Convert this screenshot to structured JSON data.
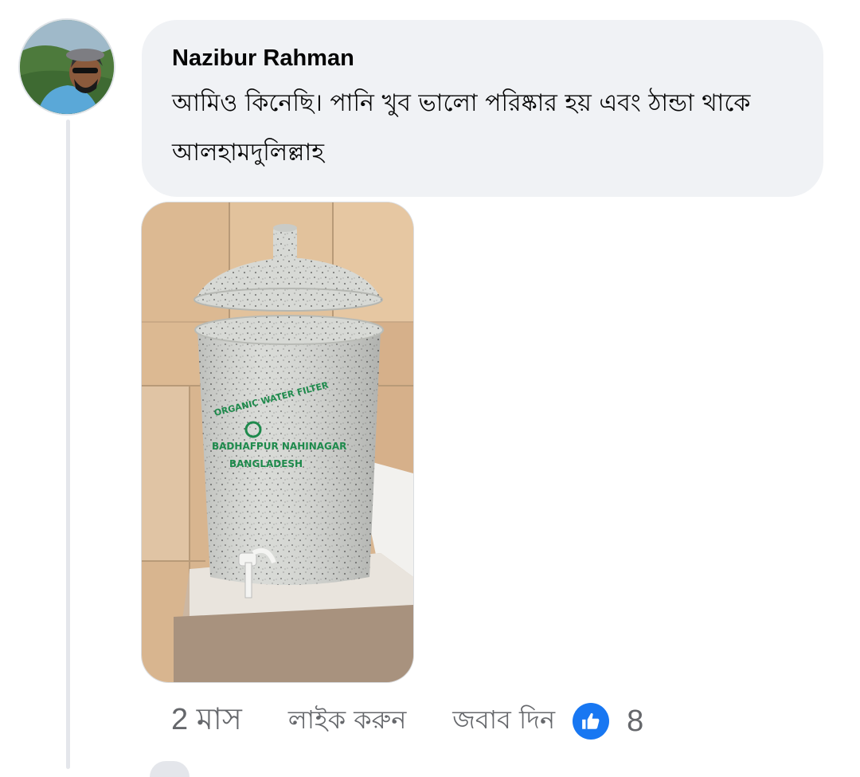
{
  "comment": {
    "author": "Nazibur Rahman",
    "text": "আমিও কিনেছি। পানি খুব ভালো পরিষ্কার হয় এবং ঠান্ডা থাকে আলহামদুলিল্লাহ",
    "time": "2 মাস",
    "like_label": "লাইক করুন",
    "reply_label": "জবাব দিন",
    "reaction_icon": "thumbs-up-icon",
    "reaction_count": "8"
  },
  "photo": {
    "stencil_text": [
      "ORGANIC WATER FILTER",
      "BADHAFPUR NAHINAGAR",
      "BANGLADESH"
    ]
  },
  "colors": {
    "bubble_bg": "#f0f2f5",
    "like_blue": "#1877f2",
    "meta_gray": "#65676b",
    "stencil_green": "#1e8a4c"
  }
}
